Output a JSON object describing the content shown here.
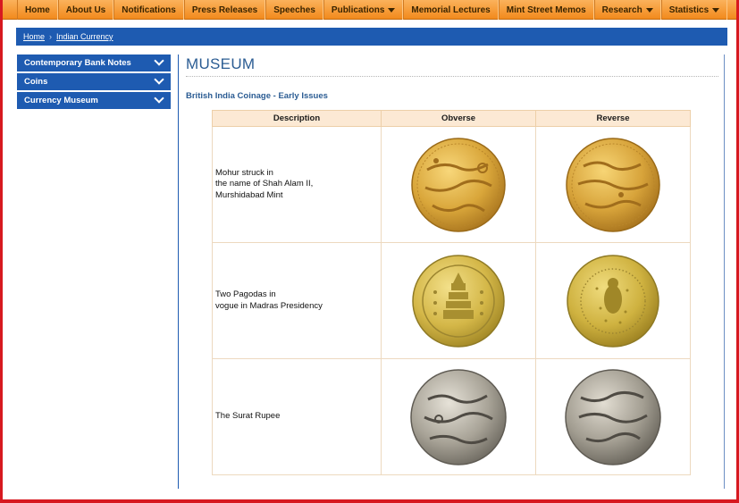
{
  "nav": [
    {
      "label": "Home",
      "dropdown": false
    },
    {
      "label": "About Us",
      "dropdown": false
    },
    {
      "label": "Notifications",
      "dropdown": false
    },
    {
      "label": "Press Releases",
      "dropdown": false
    },
    {
      "label": "Speeches",
      "dropdown": false
    },
    {
      "label": "Publications",
      "dropdown": true
    },
    {
      "label": "Memorial Lectures",
      "dropdown": false
    },
    {
      "label": "Mint Street Memos",
      "dropdown": false
    },
    {
      "label": "Research",
      "dropdown": true
    },
    {
      "label": "Statistics",
      "dropdown": true
    }
  ],
  "breadcrumb": {
    "home": "Home",
    "current": "Indian Currency"
  },
  "sidebar": [
    {
      "label": "Contemporary Bank Notes"
    },
    {
      "label": "Coins"
    },
    {
      "label": "Currency Museum"
    }
  ],
  "main": {
    "title": "MUSEUM",
    "subtitle": "British India Coinage - Early Issues",
    "table": {
      "headers": [
        "Description",
        "Obverse",
        "Reverse"
      ],
      "rows": [
        {
          "desc_lines": [
            "Mohur struck in",
            "the name of Shah Alam II,",
            "Murshidabad Mint"
          ],
          "obverse": "gold-mohur-obverse-image",
          "reverse": "gold-mohur-reverse-image"
        },
        {
          "desc_lines": [
            "Two Pagodas in",
            "vogue in Madras Presidency"
          ],
          "obverse": "two-pagodas-obverse-image",
          "reverse": "two-pagodas-reverse-image"
        },
        {
          "desc_lines": [
            "The Surat Rupee"
          ],
          "obverse": "surat-rupee-obverse-image",
          "reverse": "surat-rupee-reverse-image"
        }
      ]
    }
  },
  "colors": {
    "nav_orange": "#f28a1d",
    "brand_blue": "#1e5bb1",
    "title_blue": "#2b5c93",
    "frame_red": "#d71920",
    "gold": "#d9a63a",
    "silver": "#9c9890"
  }
}
